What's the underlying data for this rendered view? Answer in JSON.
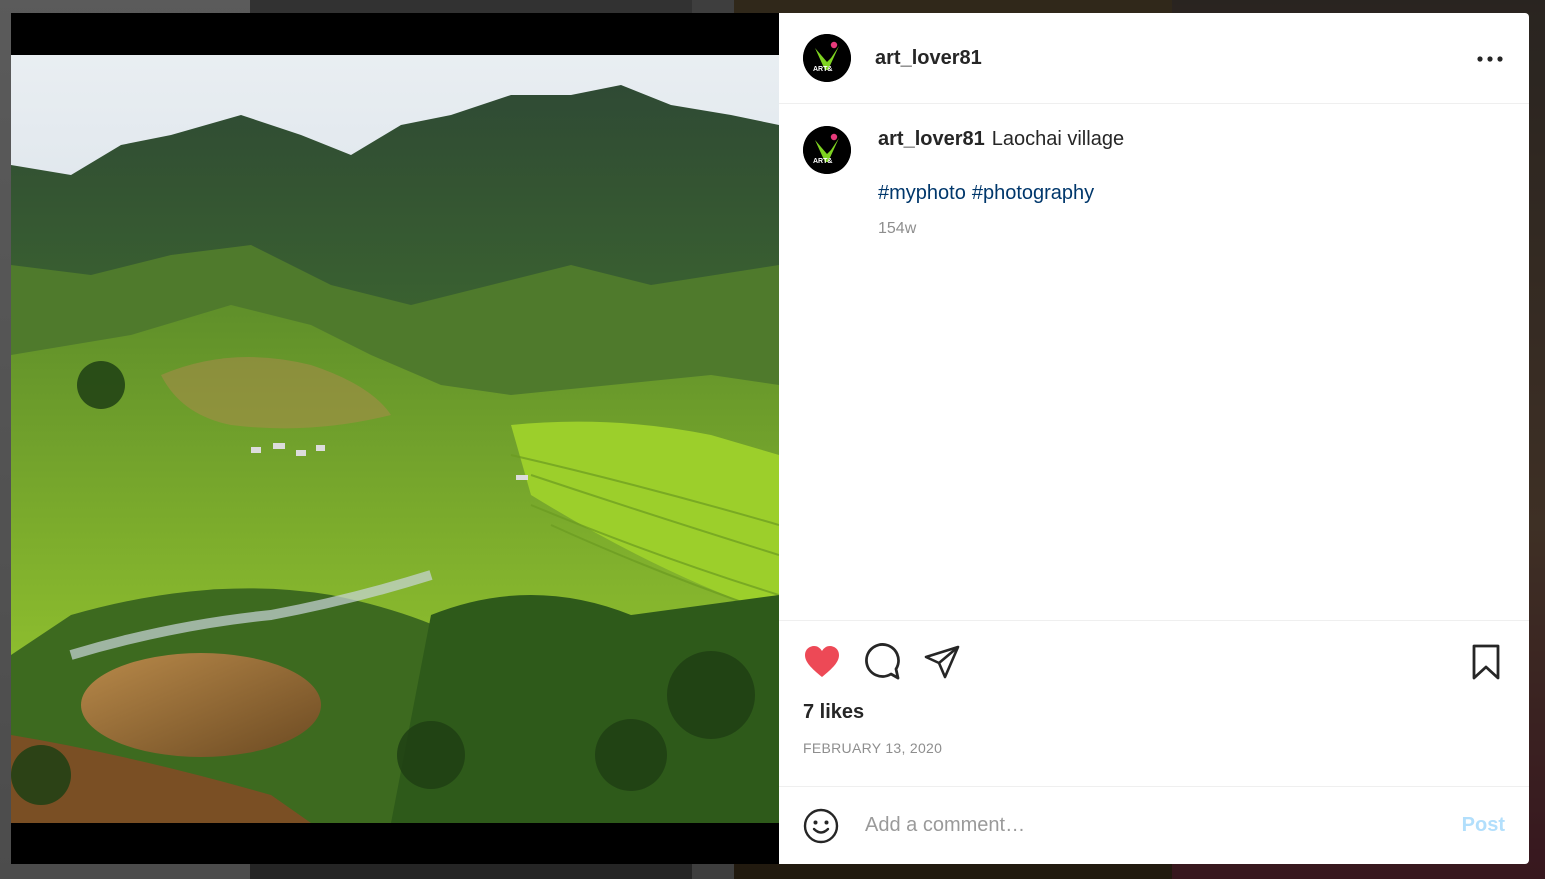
{
  "post": {
    "username": "art_lover81",
    "avatar_icon": "art-logo-icon",
    "avatar_text": "ART&",
    "caption_text": "Laochai village",
    "hashtags": [
      "#myphoto",
      "#photography"
    ],
    "time_ago": "154w",
    "likes": "7 likes",
    "date": "FEBRUARY 13, 2020",
    "liked": true
  },
  "actions": {
    "like_icon": "heart-icon",
    "comment_icon": "comment-icon",
    "share_icon": "paper-plane-icon",
    "save_icon": "bookmark-icon",
    "more_icon": "more-horizontal-icon"
  },
  "comment_box": {
    "placeholder": "Add a comment…",
    "value": "",
    "post_label": "Post",
    "emoji_icon": "smiley-icon"
  },
  "colors": {
    "like_red": "#ed4956",
    "hashtag_blue": "#00376b",
    "post_disabled": "#b2dffc",
    "muted": "#8e8e8e",
    "logo_green": "#7ed321",
    "logo_pink": "#e63b7a"
  }
}
